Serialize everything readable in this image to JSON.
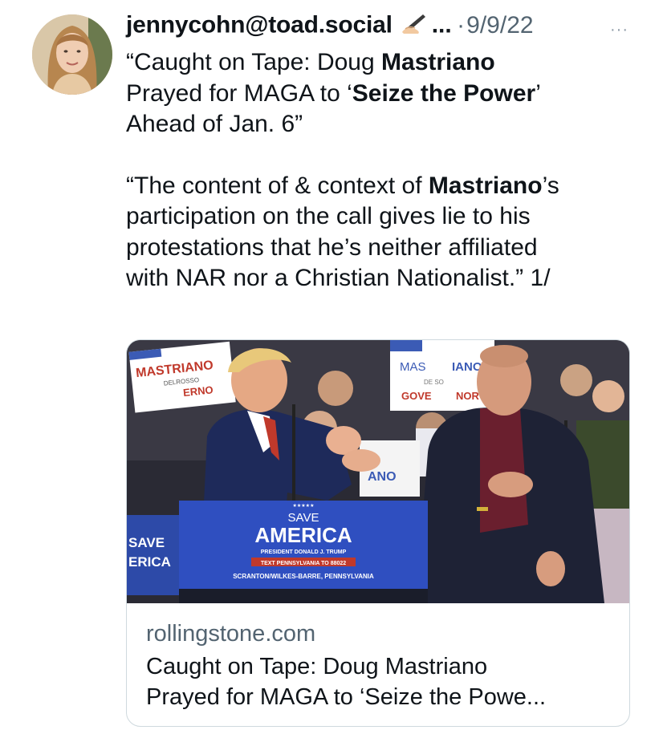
{
  "tweet": {
    "author_handle": "jennycohn@toad.social",
    "author_suffix": "...",
    "separator": "·",
    "date": "9/9/22",
    "more": "···",
    "pen_icon": "writing-hand-icon",
    "text_lines": {
      "l1_pre": "“Caught on Tape: Doug ",
      "l1_bold": "Mastriano",
      "l2_pre": "Prayed for MAGA to ‘",
      "l2_bold": "Seize the Power",
      "l2_post": "’",
      "l3": "Ahead of Jan. 6”",
      "l4_pre": "“The content of & context of ",
      "l4_bold": "Mastriano",
      "l4_post": "’s",
      "l5": "participation on the call gives lie to his",
      "l6": "protestations that he’s neither affiliated",
      "l7": "with NAR nor a Christian Nationalist.” 1/"
    }
  },
  "card": {
    "domain": "rollingstone.com",
    "title_line1": "Caught on Tape: Doug Mastriano",
    "title_line2": "Prayed for MAGA to ‘Seize the Powe...",
    "image": {
      "sign_left_title": "MASTRIANO",
      "sign_left_small": "DELROSSO",
      "sign_left_sub": "ERNO",
      "sign_right_left": "MAS",
      "sign_right_right": "IANO",
      "sign_right_small": "DE  SO",
      "sign_right_bottom_left": "GOVE",
      "sign_right_bottom_right": "NOR",
      "sign_mid": "ANO",
      "podium_stars": "★★★★★",
      "podium_save": "SAVE",
      "podium_america": "AMERICA",
      "podium_president": "PRESIDENT DONALD J. TRUMP",
      "podium_text": "TEXT PENNSYLVANIA TO 88022",
      "podium_location": "SCRANTON/WILKES-BARRE, PENNSYLVANIA",
      "side_save": "SAVE",
      "side_erica": "ERICA"
    }
  }
}
